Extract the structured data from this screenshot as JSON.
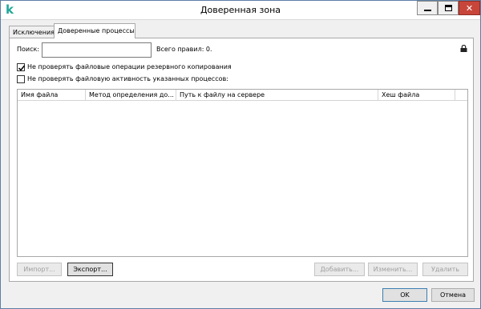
{
  "window": {
    "title": "Доверенная зона",
    "close_glyph": "✕"
  },
  "tabs": [
    {
      "label": "Исключения",
      "active": false
    },
    {
      "label": "Доверенные процессы",
      "active": true
    }
  ],
  "search": {
    "label": "Поиск:",
    "value": "",
    "placeholder": ""
  },
  "rules_total": "Всего правил: 0.",
  "checkboxes": [
    {
      "label": "Не проверять файловые операции резервного копирования",
      "checked": true
    },
    {
      "label": "Не проверять файловую активность указанных процессов:",
      "checked": false
    }
  ],
  "table": {
    "columns": [
      "Имя файла",
      "Метод определения до...",
      "Путь к файлу на сервере",
      "Хеш файла"
    ],
    "rows": []
  },
  "buttons": {
    "import": "Импорт...",
    "export": "Экспорт...",
    "add": "Добавить...",
    "edit": "Изменить...",
    "delete": "Удалить",
    "ok": "OK",
    "cancel": "Отмена"
  },
  "icons": {
    "app": "kaspersky-k-icon",
    "lock": "lock-icon",
    "checkmark": "checkmark-icon"
  },
  "colors": {
    "app_icon": "#21a89a",
    "close_button": "#c8453a",
    "window_border": "#5e7ea6"
  }
}
